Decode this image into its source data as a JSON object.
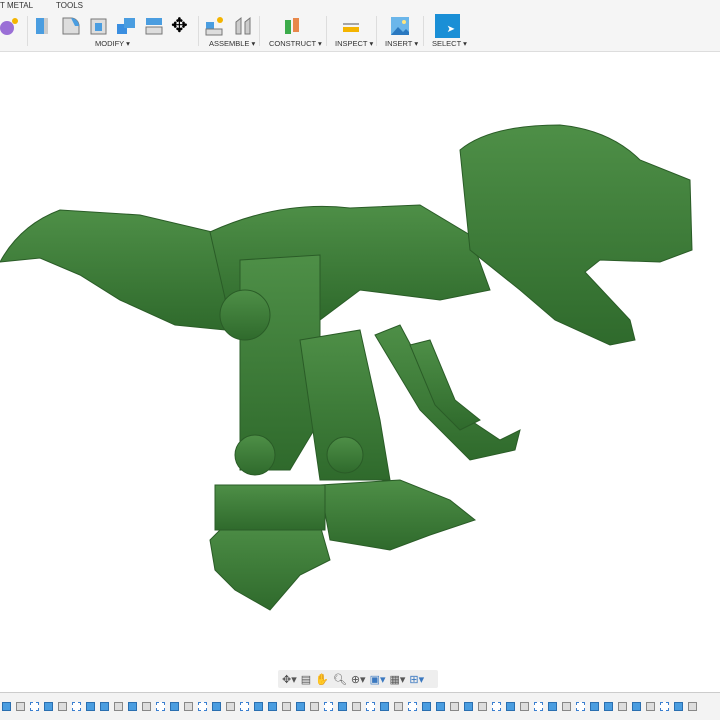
{
  "toolbar": {
    "tabs": [
      "T METAL",
      "TOOLS"
    ],
    "groups": [
      {
        "label": "MODIFY ▾",
        "icons": [
          "press-pull-icon",
          "fillet-icon",
          "shell-icon",
          "combine-icon",
          "split-face-icon",
          "move-icon"
        ]
      },
      {
        "label": "ASSEMBLE ▾",
        "icons": [
          "new-component-icon",
          "joint-icon"
        ]
      },
      {
        "label": "CONSTRUCT ▾",
        "icons": [
          "plane-icon"
        ]
      },
      {
        "label": "INSPECT ▾",
        "icons": [
          "measure-icon"
        ]
      },
      {
        "label": "INSERT ▾",
        "icons": [
          "insert-image-icon"
        ]
      },
      {
        "label": "SELECT ▾",
        "icons": [
          "select-icon"
        ]
      }
    ],
    "colors": {
      "accent": "#1a8fd6",
      "model": "#3f7d3a"
    }
  },
  "navbar": {
    "icons": [
      "orbit-icon",
      "look-at-icon",
      "pan-icon",
      "zoom-icon",
      "fit-icon",
      "display-settings-icon",
      "visual-style-icon",
      "viewports-icon"
    ]
  },
  "timeline": {
    "pattern": [
      "b",
      "g",
      "s",
      "b",
      "g",
      "s",
      "b",
      "b",
      "g",
      "b",
      "g",
      "s"
    ]
  }
}
